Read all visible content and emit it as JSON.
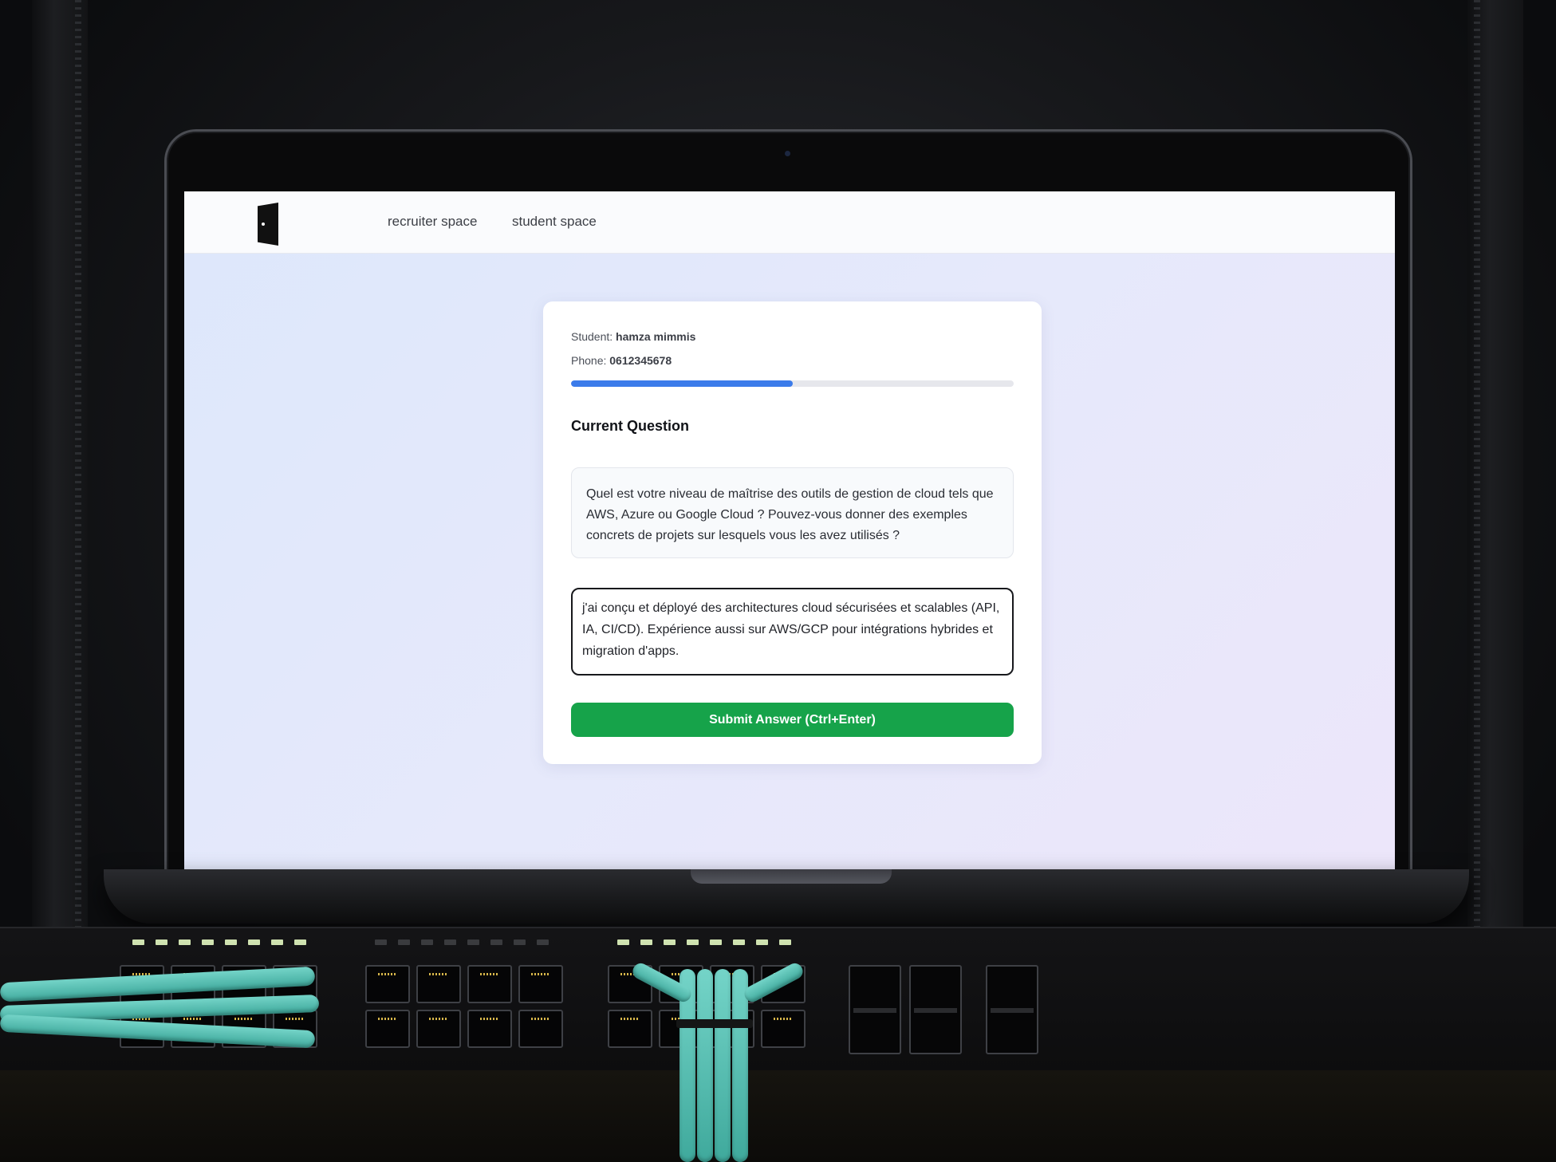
{
  "nav": {
    "links": [
      {
        "label": "recruiter space"
      },
      {
        "label": "student space"
      }
    ]
  },
  "interview": {
    "student_label": "Student:",
    "student_name": "hamza mimmis",
    "phone_label": "Phone:",
    "phone": "0612345678",
    "progress_fraction": 0.5,
    "section_title": "Current Question",
    "question": "Quel est votre niveau de maîtrise des outils de gestion de cloud tels que AWS, Azure ou Google Cloud ? Pouvez-vous donner des exemples concrets de projets sur lesquels vous les avez utilisés ?",
    "answer": "j'ai conçu et déployé des architectures cloud sécurisées et scalables (API, IA, CI/CD). Expérience aussi sur AWS/GCP pour intégrations hybrides et migration d'apps.",
    "submit_label": "Submit Answer (Ctrl+Enter)"
  },
  "colors": {
    "progress": "#3b7bea",
    "submit": "#16a34a",
    "cable": "#5cc4b7"
  }
}
